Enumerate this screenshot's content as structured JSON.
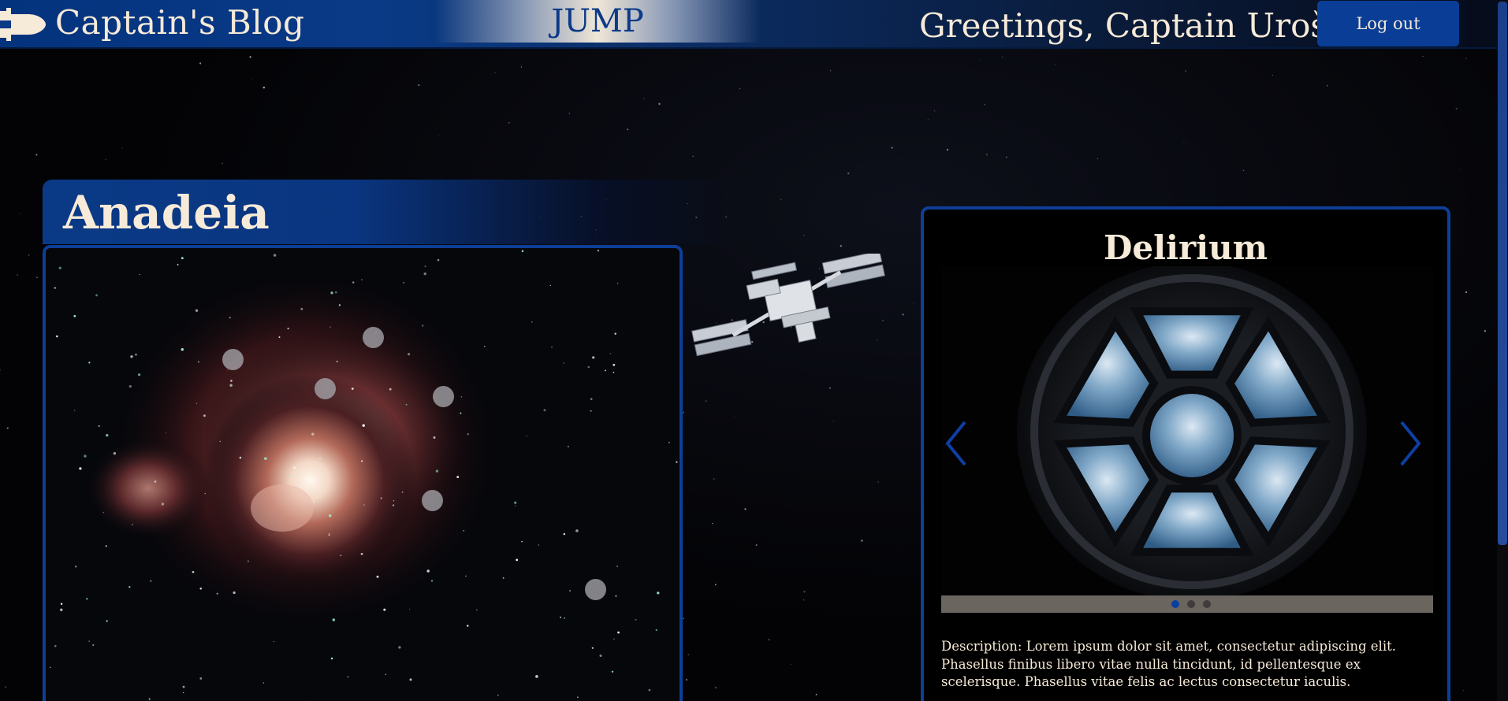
{
  "header": {
    "site_title": "Captain's Blog",
    "jump_label": "JUMP",
    "greeting": "Greetings, Captain Uroš",
    "logout_label": "Log out",
    "logo_icon": "space-shuttle-icon"
  },
  "planet": {
    "title": "Anadeia",
    "map_image": "orion-nebula-image",
    "marker_count": 7
  },
  "gallery": {
    "title": "Delirium",
    "image": "space-station-cupola-window-image",
    "prev_icon": "chevron-left-icon",
    "next_icon": "chevron-right-icon",
    "slides": 3,
    "active_slide": 1,
    "description": "Description: Lorem ipsum dolor sit amet, consectetur adipiscing elit. Phasellus finibus libero vitae nulla tincidunt, id pellentesque ex scelerisque. Phasellus vitae felis ac lectus consectetur iaculis."
  },
  "colors": {
    "accent_blue": "#0a3a86",
    "frame_blue": "#0d3f98",
    "text_cream": "#f6ead8"
  }
}
